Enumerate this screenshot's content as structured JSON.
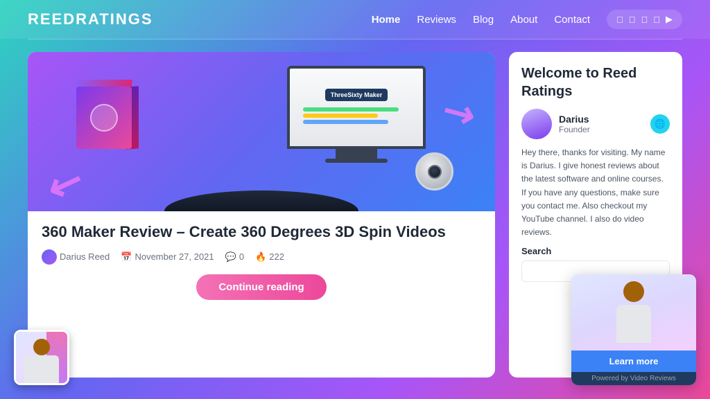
{
  "header": {
    "logo": "ReedRatings",
    "nav": {
      "items": [
        {
          "label": "Home",
          "active": true
        },
        {
          "label": "Reviews",
          "active": false
        },
        {
          "label": "Blog",
          "active": false
        },
        {
          "label": "About",
          "active": false
        },
        {
          "label": "Contact",
          "active": false
        }
      ]
    },
    "social": {
      "icons": [
        "f",
        "t",
        "p",
        "t",
        "y"
      ]
    }
  },
  "article": {
    "title": "360 Maker Review – Create 360 Degrees 3D Spin Videos",
    "author": "Darius Reed",
    "date": "November 27, 2021",
    "comments": "0",
    "views": "222",
    "continue_button": "Continue reading",
    "image_badge": "ThreeSixty Maker"
  },
  "sidebar": {
    "welcome_title": "Welcome to Reed Ratings",
    "author_name": "Darius",
    "author_role": "Founder",
    "description": "Hey there, thanks for visiting. My name is Darius. I give honest reviews about the latest software and online courses. If you have any questions, make sure you contact me. Also checkout my YouTube channel. I also do video reviews.",
    "search_label": "Search",
    "search_placeholder": ""
  },
  "video_widget": {
    "learn_more_label": "Learn more",
    "powered_by": "Powered by Video Reviews"
  },
  "colors": {
    "accent_pink": "#ec4899",
    "accent_purple": "#a855f7",
    "accent_blue": "#3b82f6",
    "accent_cyan": "#22d3ee"
  }
}
